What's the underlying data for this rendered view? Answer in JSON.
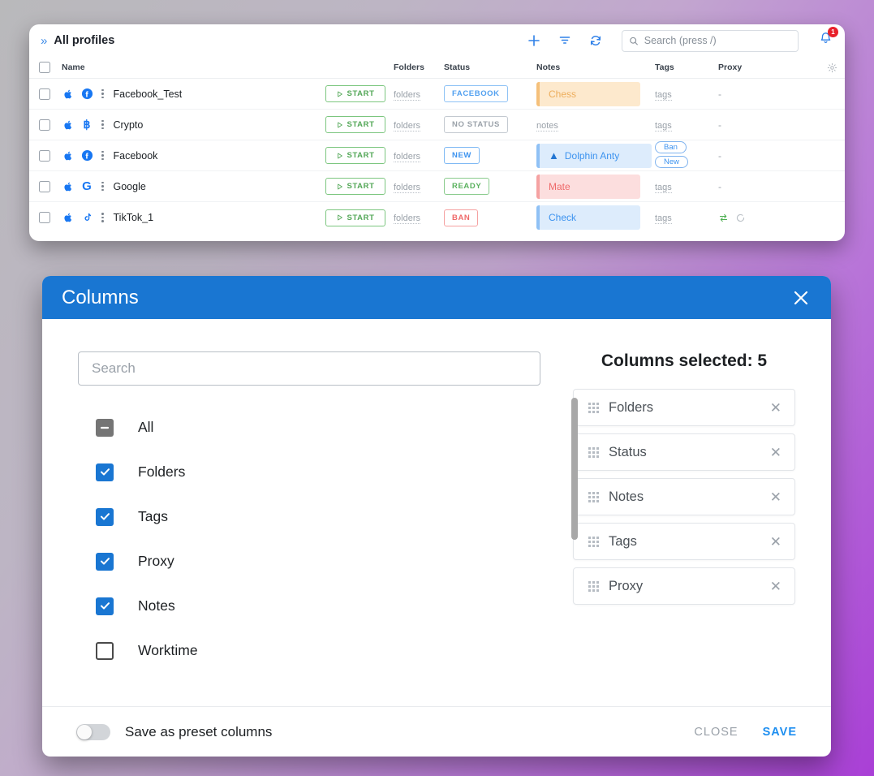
{
  "profiles_window": {
    "title": "All profiles",
    "expand_icon": "chevron-double-right-icon",
    "toolbar": {
      "add_icon": "plus-icon",
      "filter_icon": "filter-icon",
      "refresh_icon": "refresh-icon",
      "notification_icon": "bell-icon",
      "notification_count": "1"
    },
    "search": {
      "placeholder": "Search (press /)",
      "value": ""
    },
    "columns": [
      "Name",
      "Folders",
      "Status",
      "Notes",
      "Tags",
      "Proxy"
    ],
    "settings_icon": "gear-icon",
    "rows": [
      {
        "name": "Facebook_Test",
        "os_icon": "apple-icon",
        "platform_icon": "facebook-icon",
        "menu_icon": "kebab-menu-icon",
        "start_label": "START",
        "folders": "folders",
        "status": "FACEBOOK",
        "status_style": "facebook",
        "note": "Chess",
        "note_style": "orange",
        "note_warn": false,
        "tags": "tags",
        "tag_chips": [],
        "proxy": "-"
      },
      {
        "name": "Crypto",
        "os_icon": "apple-icon",
        "platform_icon": "bitcoin-icon",
        "menu_icon": "kebab-menu-icon",
        "start_label": "START",
        "folders": "folders",
        "status": "NO STATUS",
        "status_style": "nostatus",
        "note": "notes",
        "note_style": "plain",
        "note_warn": false,
        "tags": "tags",
        "tag_chips": [],
        "proxy": "-"
      },
      {
        "name": "Facebook",
        "os_icon": "apple-icon",
        "platform_icon": "facebook-icon",
        "menu_icon": "kebab-menu-icon",
        "start_label": "START",
        "folders": "folders",
        "status": "NEW",
        "status_style": "new",
        "note": "Dolphin Anty",
        "note_style": "blue",
        "note_warn": true,
        "tags": "",
        "tag_chips": [
          "Ban",
          "New"
        ],
        "proxy": "-"
      },
      {
        "name": "Google",
        "os_icon": "apple-icon",
        "platform_icon": "google-icon",
        "menu_icon": "kebab-menu-icon",
        "start_label": "START",
        "folders": "folders",
        "status": "READY",
        "status_style": "ready",
        "note": "Mate",
        "note_style": "red",
        "note_warn": false,
        "tags": "tags",
        "tag_chips": [],
        "proxy": "-"
      },
      {
        "name": "TikTok_1",
        "os_icon": "apple-icon",
        "platform_icon": "tiktok-icon",
        "menu_icon": "kebab-menu-icon",
        "start_label": "START",
        "folders": "folders",
        "status": "BAN",
        "status_style": "ban",
        "note": "Check",
        "note_style": "blue",
        "note_warn": false,
        "tags": "tags",
        "tag_chips": [],
        "proxy": "",
        "proxy_icons": [
          "swap-icon",
          "refresh-icon"
        ]
      }
    ]
  },
  "dialog": {
    "title": "Columns",
    "close_icon": "close-icon",
    "search": {
      "placeholder": "Search",
      "value": ""
    },
    "options": [
      {
        "label": "All",
        "state": "indeterminate"
      },
      {
        "label": "Folders",
        "state": "checked"
      },
      {
        "label": "Tags",
        "state": "checked"
      },
      {
        "label": "Proxy",
        "state": "checked"
      },
      {
        "label": "Notes",
        "state": "checked"
      },
      {
        "label": "Worktime",
        "state": "unchecked"
      }
    ],
    "selected_title": "Columns selected: 5",
    "selected": [
      {
        "label": "Folders",
        "grip_icon": "drag-handle-icon",
        "remove_icon": "close-icon"
      },
      {
        "label": "Status",
        "grip_icon": "drag-handle-icon",
        "remove_icon": "close-icon"
      },
      {
        "label": "Notes",
        "grip_icon": "drag-handle-icon",
        "remove_icon": "close-icon"
      },
      {
        "label": "Tags",
        "grip_icon": "drag-handle-icon",
        "remove_icon": "close-icon"
      },
      {
        "label": "Proxy",
        "grip_icon": "drag-handle-icon",
        "remove_icon": "close-icon"
      }
    ],
    "footer": {
      "toggle_label": "Save as preset columns",
      "toggle_on": false,
      "close_label": "CLOSE",
      "save_label": "SAVE"
    }
  },
  "colors": {
    "accent_blue": "#1976d2",
    "start_green": "#53a757",
    "danger_red": "#ef6a6a",
    "badge_red": "#e8202a"
  }
}
